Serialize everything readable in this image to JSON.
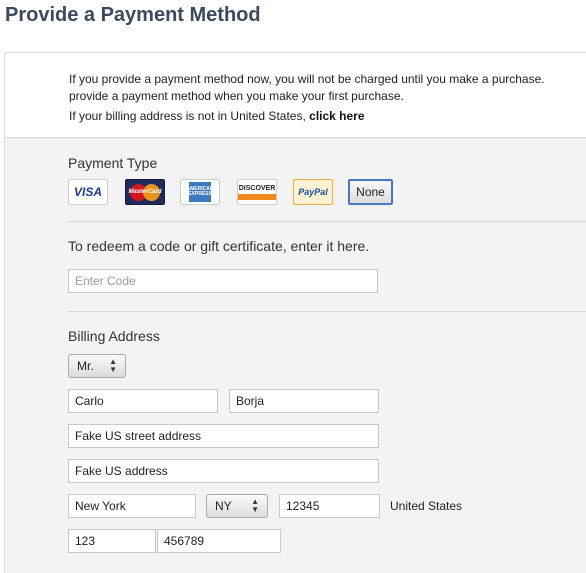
{
  "page": {
    "title": "Provide a Payment Method"
  },
  "intro": {
    "line1": "If you provide a payment method now, you will not be charged until you make a purchase.",
    "line2": "provide a payment method when you make your first purchase.",
    "line3_prefix": "If your billing address is not in United States,",
    "line3_link": "click here"
  },
  "payment_type": {
    "label": "Payment Type",
    "cards": [
      {
        "name": "VISA",
        "icon": "visa-icon"
      },
      {
        "name": "MasterCard",
        "icon": "mastercard-icon"
      },
      {
        "name": "AMERICAN EXPRESS",
        "icon": "amex-icon"
      },
      {
        "name": "DISCOVER",
        "icon": "discover-icon"
      },
      {
        "name": "PayPal",
        "icon": "paypal-icon"
      }
    ],
    "none_label": "None",
    "selected": "None"
  },
  "redeem": {
    "label": "To redeem a code or gift certificate, enter it here.",
    "placeholder": "Enter Code"
  },
  "billing": {
    "label": "Billing Address",
    "salutation": "Mr.",
    "first_name": "Carlo",
    "last_name": "Borja",
    "street": "Fake US street address",
    "street2": "Fake US address",
    "city": "New York",
    "state": "NY",
    "zip": "12345",
    "country": "United States",
    "area_code": "123",
    "phone": "456789"
  }
}
